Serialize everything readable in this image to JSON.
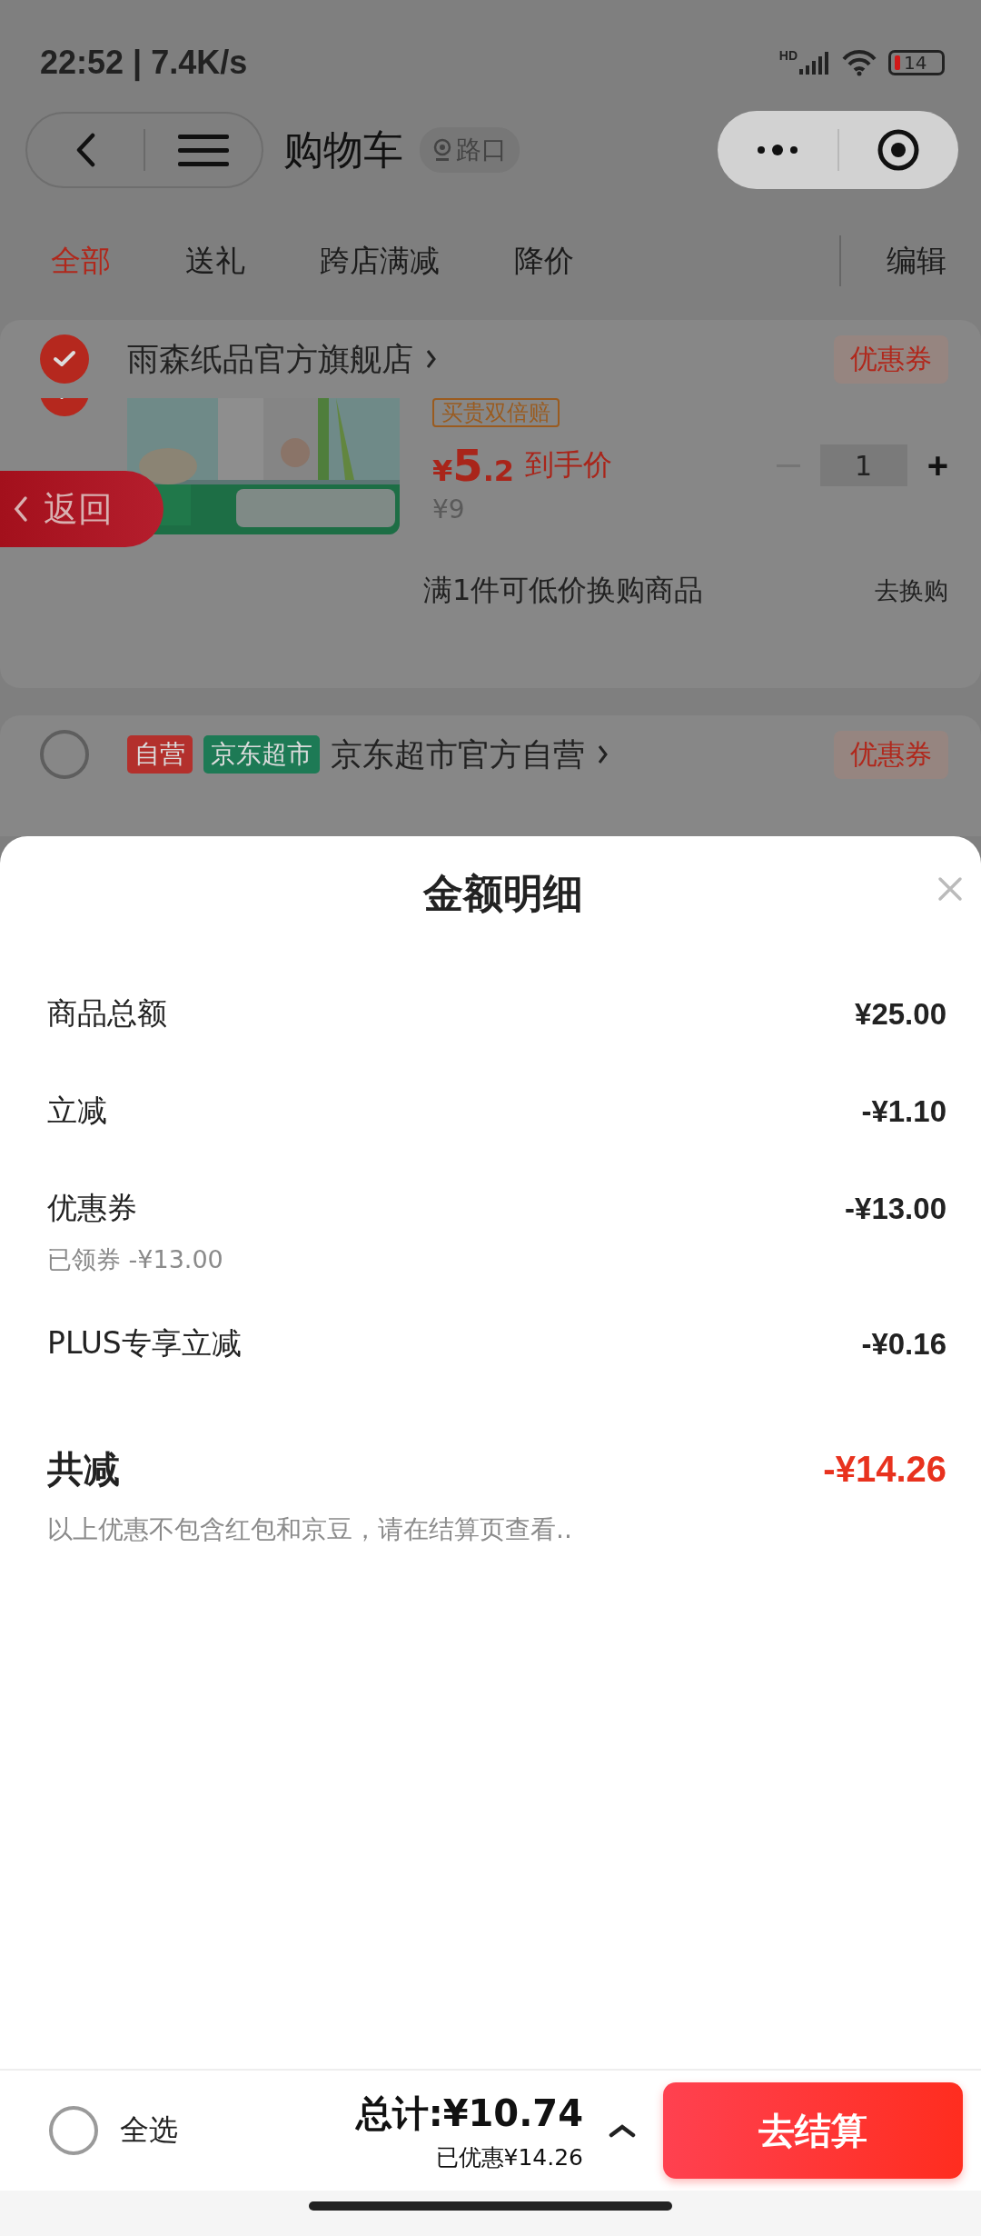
{
  "status_bar": {
    "time": "22:52 | 7.4K/s",
    "network": "HD",
    "battery": "14"
  },
  "nav": {
    "title": "购物车",
    "location": "路口"
  },
  "filter_tabs": [
    {
      "label": "全部",
      "selected": true
    },
    {
      "label": "送礼",
      "selected": false
    },
    {
      "label": "跨店满减",
      "selected": false
    },
    {
      "label": "降价",
      "selected": false
    }
  ],
  "edit_label": "编辑",
  "stores": [
    {
      "name": "雨森纸品官方旗舰店",
      "checked": true,
      "coupon": "优惠券",
      "items": [
        {
          "checked": true,
          "tag": "买贵双倍赔",
          "price_symbol": "¥",
          "price_int": "5",
          "price_dec": ".2",
          "price_note": "到手价",
          "original_price": "¥9",
          "quantity": "1",
          "increase": "+"
        }
      ],
      "promo": {
        "text": "满1件可低价换购商品",
        "link": "去换购"
      }
    },
    {
      "name": "京东超市官方自营",
      "checked": false,
      "coupon": "优惠券",
      "badges": [
        {
          "text": "自营",
          "color": "#b3302c"
        },
        {
          "text": "京东超市",
          "color": "#1d7a55"
        }
      ]
    }
  ],
  "back_float": "返回",
  "sheet": {
    "title": "金额明细",
    "rows": [
      {
        "label": "商品总额",
        "value": "¥25.00"
      },
      {
        "label": "立减",
        "value": "-¥1.10"
      },
      {
        "label": "优惠券",
        "value": "-¥13.00",
        "sub": "已领券 -¥13.00"
      },
      {
        "label": "PLUS专享立减",
        "value": "-¥0.16"
      }
    ],
    "total": {
      "label": "共减",
      "value": "-¥14.26"
    },
    "note": "以上优惠不包含红包和京豆，请在结算页查看.."
  },
  "bottom_bar": {
    "select_all": {
      "label": "全选",
      "checked": false
    },
    "total": "总计:¥10.74",
    "saved": "已优惠¥14.26",
    "checkout": "去结算"
  }
}
